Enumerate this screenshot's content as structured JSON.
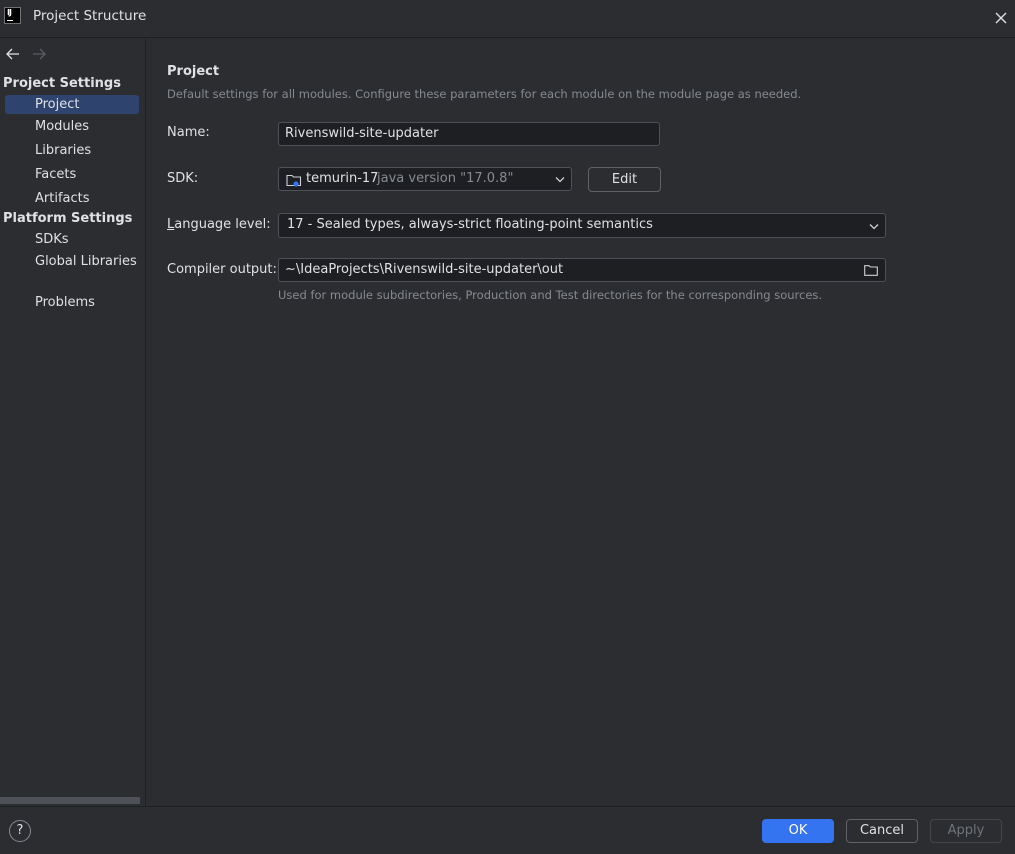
{
  "window": {
    "title": "Project Structure",
    "logo_text": "IJ"
  },
  "sidebar": {
    "project_settings_label": "Project Settings",
    "project_items": [
      "Project",
      "Modules",
      "Libraries",
      "Facets",
      "Artifacts"
    ],
    "platform_settings_label": "Platform Settings",
    "platform_items": [
      "SDKs",
      "Global Libraries"
    ],
    "problems_label": "Problems",
    "selected": "Project"
  },
  "main": {
    "title": "Project",
    "description": "Default settings for all modules. Configure these parameters for each module on the module page as needed.",
    "name_label": "Name:",
    "name_value": "Rivenswild-site-updater",
    "sdk_label": "SDK:",
    "sdk_name": "temurin-17",
    "sdk_version": "java version \"17.0.8\"",
    "edit_label": "Edit",
    "language_label_underlined": "L",
    "language_label_rest": "anguage level:",
    "language_value": "17 - Sealed types, always-strict floating-point semantics",
    "compiler_label": "Compiler output:",
    "compiler_value": "~\\IdeaProjects\\Rivenswild-site-updater\\out",
    "compiler_hint": "Used for module subdirectories, Production and Test directories for the corresponding sources."
  },
  "footer": {
    "help": "?",
    "ok": "OK",
    "cancel": "Cancel",
    "apply": "Apply"
  },
  "colors": {
    "accent": "#3574f0",
    "selection": "#2e436e",
    "background": "#2b2d30",
    "field_bg": "#1e1f22"
  },
  "icons": [
    "app-logo-icon",
    "close-icon",
    "back-arrow-icon",
    "forward-arrow-icon",
    "sdk-folder-icon",
    "chevron-down-icon",
    "folder-icon",
    "help-icon"
  ]
}
